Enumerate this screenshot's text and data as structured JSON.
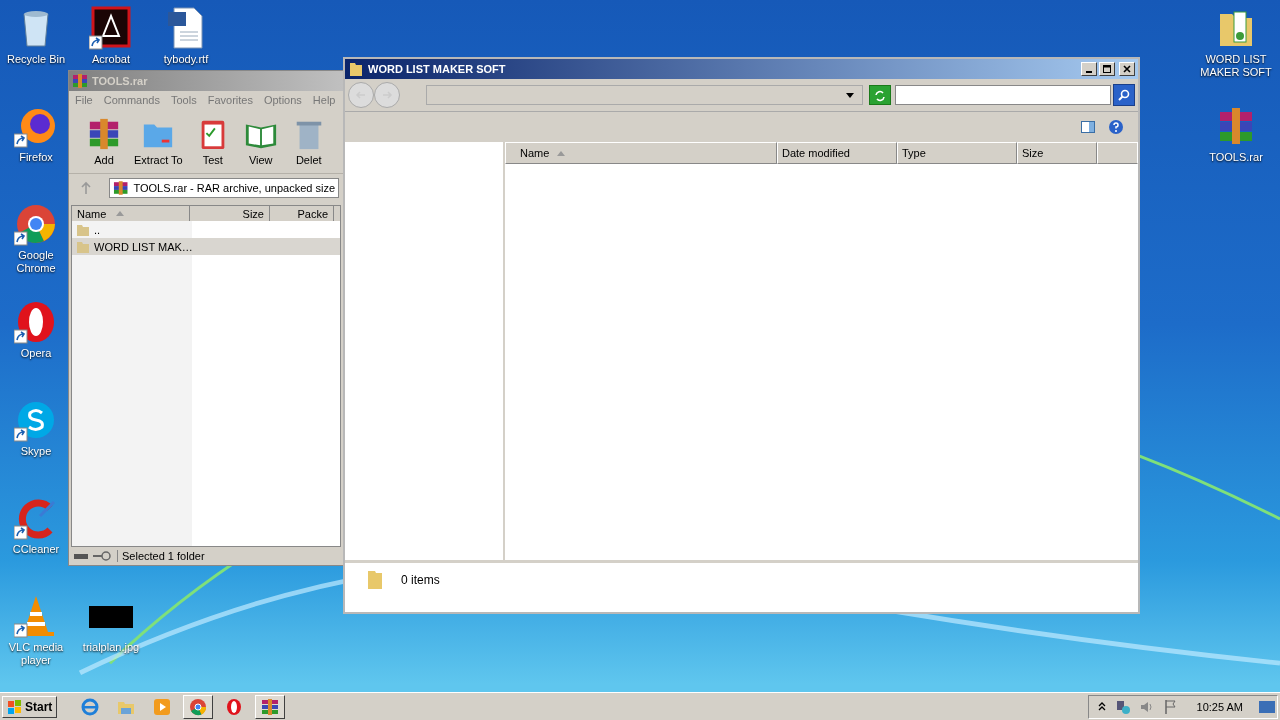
{
  "desktop_icons": [
    {
      "label": "Recycle Bin",
      "kind": "recycle",
      "shortcut": false
    },
    {
      "label": "Acrobat",
      "kind": "acrobat",
      "shortcut": true
    },
    {
      "label": "tybody.rtf",
      "kind": "document",
      "shortcut": false
    },
    {
      "label": "Firefox",
      "kind": "firefox",
      "shortcut": true
    },
    {
      "label": "Google Chrome",
      "kind": "chrome",
      "shortcut": true
    },
    {
      "label": "Opera",
      "kind": "opera",
      "shortcut": true
    },
    {
      "label": "Skype",
      "kind": "skype",
      "shortcut": true
    },
    {
      "label": "CCleaner",
      "kind": "ccleaner",
      "shortcut": true
    },
    {
      "label": "VLC media player",
      "kind": "vlc",
      "shortcut": true
    },
    {
      "label": "trialplan.jpg",
      "kind": "thumbnail",
      "shortcut": false
    },
    {
      "label": "WORD LIST MAKER SOFT",
      "kind": "folder",
      "shortcut": false
    },
    {
      "label": "TOOLS.rar",
      "kind": "rar",
      "shortcut": false
    }
  ],
  "winrar": {
    "title": "TOOLS.rar",
    "active": false,
    "menu": [
      "File",
      "Commands",
      "Tools",
      "Favorites",
      "Options",
      "Help"
    ],
    "toolbar": [
      {
        "label": "Add",
        "kind": "add"
      },
      {
        "label": "Extract To",
        "kind": "extract"
      },
      {
        "label": "Test",
        "kind": "test"
      },
      {
        "label": "View",
        "kind": "view"
      },
      {
        "label": "Delet",
        "kind": "delete"
      }
    ],
    "address": "TOOLS.rar - RAR archive, unpacked size",
    "columns": [
      {
        "label": "Name",
        "sorted": true
      },
      {
        "label": "Size",
        "sorted": false
      },
      {
        "label": "Packe",
        "sorted": false
      }
    ],
    "rows": [
      {
        "name": "..",
        "selected": false
      },
      {
        "name": "WORD LIST MAK…",
        "selected": true
      }
    ],
    "status": "Selected 1 folder"
  },
  "explorer": {
    "title": "WORD LIST MAKER SOFT",
    "active": true,
    "columns": [
      {
        "label": "Name",
        "sorted": true
      },
      {
        "label": "Date modified",
        "sorted": false
      },
      {
        "label": "Type",
        "sorted": false
      },
      {
        "label": "Size",
        "sorted": false
      }
    ],
    "status": "0 items"
  },
  "taskbar": {
    "start": "Start",
    "buttons": [
      {
        "kind": "ie",
        "open": false
      },
      {
        "kind": "explorer",
        "open": false
      },
      {
        "kind": "media",
        "open": false
      },
      {
        "kind": "chrome",
        "open": true
      },
      {
        "kind": "opera",
        "open": false
      },
      {
        "kind": "rar",
        "open": true
      }
    ],
    "clock": "10:25 AM"
  }
}
